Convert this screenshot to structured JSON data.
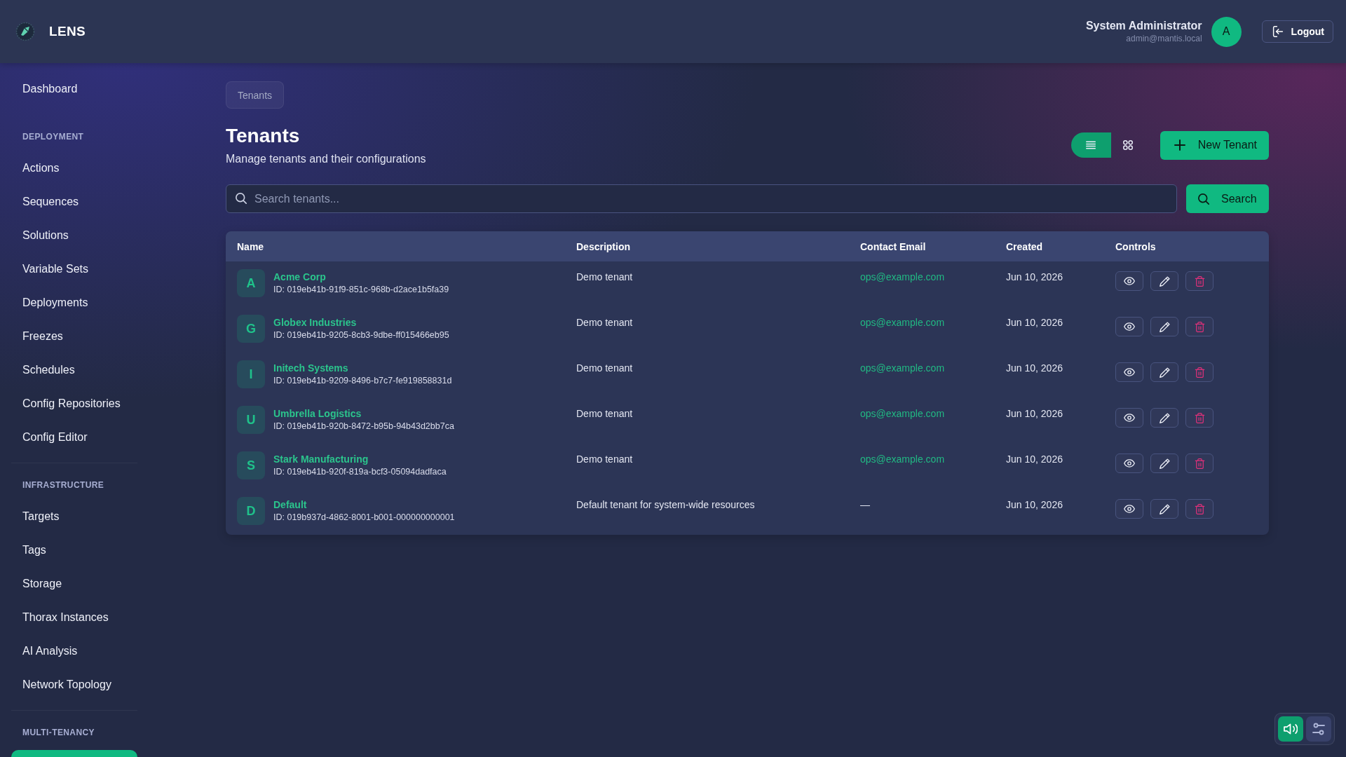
{
  "app": {
    "name": "LENS"
  },
  "user": {
    "name": "System Administrator",
    "email": "admin@mantis.local",
    "avatar_initial": "A"
  },
  "logout_button": {
    "label": "Logout"
  },
  "sidebar": {
    "sections": [
      {
        "items": [
          {
            "label": "Dashboard",
            "selected": false
          }
        ]
      },
      {
        "heading": "DEPLOYMENT",
        "items": [
          {
            "label": "Actions",
            "selected": false
          },
          {
            "label": "Sequences",
            "selected": false
          },
          {
            "label": "Solutions",
            "selected": false
          },
          {
            "label": "Variable Sets",
            "selected": false
          },
          {
            "label": "Deployments",
            "selected": false
          },
          {
            "label": "Freezes",
            "selected": false
          },
          {
            "label": "Schedules",
            "selected": false
          },
          {
            "label": "Config Repositories",
            "selected": false
          },
          {
            "label": "Config Editor",
            "selected": false
          }
        ]
      },
      {
        "heading": "INFRASTRUCTURE",
        "items": [
          {
            "label": "Targets",
            "selected": false
          },
          {
            "label": "Tags",
            "selected": false
          },
          {
            "label": "Storage",
            "selected": false
          },
          {
            "label": "Thorax Instances",
            "selected": false
          },
          {
            "label": "AI Analysis",
            "selected": false
          },
          {
            "label": "Network Topology",
            "selected": false
          }
        ]
      },
      {
        "heading": "MULTI-TENANCY",
        "items": [
          {
            "selected": true
          }
        ]
      }
    ]
  },
  "breadcrumb": [
    "Tenants"
  ],
  "page": {
    "title": "Tenants",
    "subtitle": "Manage tenants and their configurations"
  },
  "view_toggle": [
    {
      "kind": "list",
      "selected": true
    },
    {
      "kind": "grid",
      "selected": false
    }
  ],
  "new_button": {
    "label": "New Tenant"
  },
  "search": {
    "placeholder": "Search tenants...",
    "button": "Search"
  },
  "table": {
    "columns": [
      "Name",
      "Description",
      "Contact Email",
      "Created",
      "Controls"
    ],
    "rows": [
      {
        "initial": "A",
        "name": "Acme Corp",
        "id": "ID: 019eb41b-91f9-851c-968b-d2ace1b5fa39",
        "description": "Demo tenant",
        "contact": {
          "kind": "link",
          "text": "ops@example.com"
        },
        "created": "Jun 10, 2026"
      },
      {
        "initial": "G",
        "name": "Globex Industries",
        "id": "ID: 019eb41b-9205-8cb3-9dbe-ff015466eb95",
        "description": "Demo tenant",
        "contact": {
          "kind": "link",
          "text": "ops@example.com"
        },
        "created": "Jun 10, 2026"
      },
      {
        "initial": "I",
        "name": "Initech Systems",
        "id": "ID: 019eb41b-9209-8496-b7c7-fe919858831d",
        "description": "Demo tenant",
        "contact": {
          "kind": "link",
          "text": "ops@example.com"
        },
        "created": "Jun 10, 2026"
      },
      {
        "initial": "U",
        "name": "Umbrella Logistics",
        "id": "ID: 019eb41b-920b-8472-b95b-94b43d2bb7ca",
        "description": "Demo tenant",
        "contact": {
          "kind": "link",
          "text": "ops@example.com"
        },
        "created": "Jun 10, 2026"
      },
      {
        "initial": "S",
        "name": "Stark Manufacturing",
        "id": "ID: 019eb41b-920f-819a-bcf3-05094dadfaca",
        "description": "Demo tenant",
        "contact": {
          "kind": "link",
          "text": "ops@example.com"
        },
        "created": "Jun 10, 2026"
      },
      {
        "initial": "D",
        "name": "Default",
        "id": "ID: 019b937d-4862-8001-b001-000000000001",
        "description": "Default tenant for system-wide resources",
        "contact": {
          "kind": "none",
          "text": "—"
        },
        "created": "Jun 10, 2026"
      }
    ]
  },
  "floating_controls": [
    {
      "kind": "sound",
      "on": true
    },
    {
      "kind": "settings",
      "on": false
    }
  ]
}
